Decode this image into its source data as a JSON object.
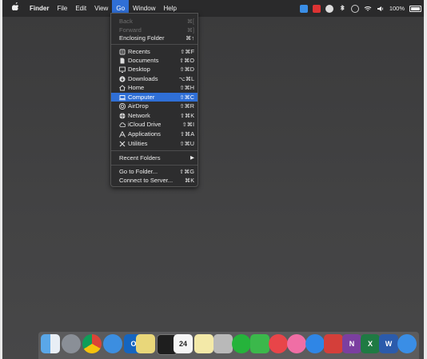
{
  "menubar": {
    "apple_glyph": "",
    "app_name": "Finder",
    "menus": [
      "File",
      "Edit",
      "View",
      "Go",
      "Window",
      "Help"
    ],
    "battery": "100%"
  },
  "go_menu": {
    "items": [
      {
        "label": "Back",
        "shortcut": "⌘[",
        "disabled": true
      },
      {
        "label": "Forward",
        "shortcut": "⌘]",
        "disabled": true
      },
      {
        "label": "Enclosing Folder",
        "shortcut": "⌘↑"
      },
      {
        "label": "Recents",
        "shortcut": "⇧⌘F",
        "icon": "recents-icon"
      },
      {
        "label": "Documents",
        "shortcut": "⇧⌘O",
        "icon": "documents-icon"
      },
      {
        "label": "Desktop",
        "shortcut": "⇧⌘D",
        "icon": "desktop-icon"
      },
      {
        "label": "Downloads",
        "shortcut": "⌥⌘L",
        "icon": "downloads-icon"
      },
      {
        "label": "Home",
        "shortcut": "⇧⌘H",
        "icon": "home-icon"
      },
      {
        "label": "Computer",
        "shortcut": "⇧⌘C",
        "icon": "computer-icon",
        "highlighted": true
      },
      {
        "label": "AirDrop",
        "shortcut": "⇧⌘R",
        "icon": "airdrop-icon"
      },
      {
        "label": "Network",
        "shortcut": "⇧⌘K",
        "icon": "network-icon"
      },
      {
        "label": "iCloud Drive",
        "shortcut": "⇧⌘I",
        "icon": "icloud-icon"
      },
      {
        "label": "Applications",
        "shortcut": "⇧⌘A",
        "icon": "applications-icon"
      },
      {
        "label": "Utilities",
        "shortcut": "⇧⌘U",
        "icon": "utilities-icon"
      },
      {
        "label": "Recent Folders",
        "shortcut": "▶"
      },
      {
        "label": "Go to Folder...",
        "shortcut": "⇧⌘G"
      },
      {
        "label": "Connect to Server...",
        "shortcut": "⌘K"
      }
    ]
  },
  "dock": {
    "calendar_day": "24",
    "apps": [
      "finder-icon",
      "launchpad-icon",
      "chrome-icon",
      "safari-icon",
      "outlook-icon",
      "notes-icon",
      "terminal-icon",
      "calendar-icon",
      "stickies-icon",
      "preview-icon",
      "whatsapp-icon",
      "facetime-icon",
      "news-icon",
      "itunes-icon",
      "app-store-icon",
      "photo-booth-icon",
      "onenote-icon",
      "excel-icon",
      "word-icon",
      "icloud-icon"
    ]
  }
}
